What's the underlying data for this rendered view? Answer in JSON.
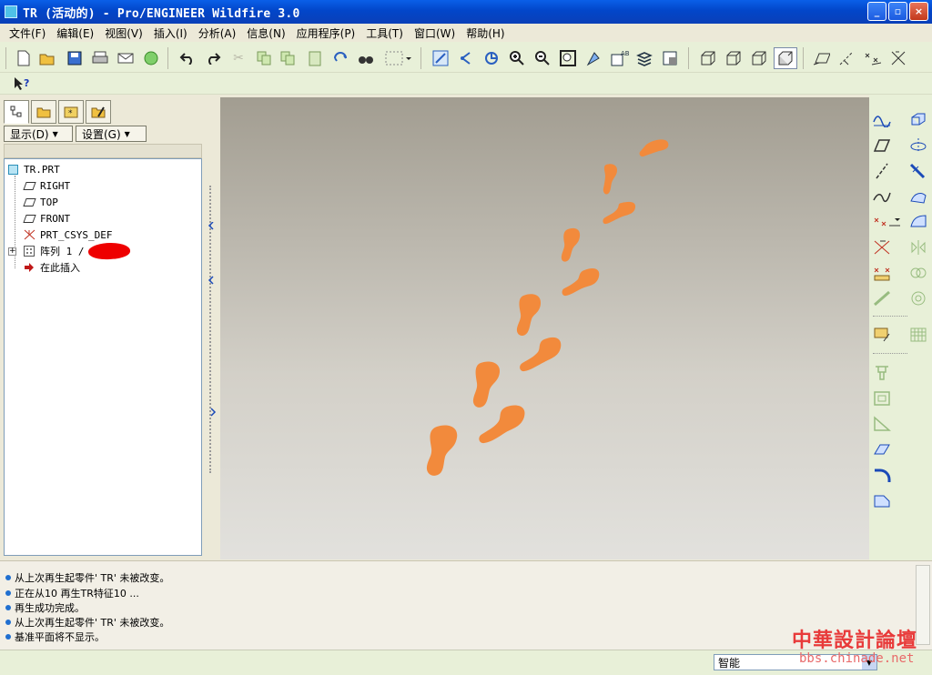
{
  "window": {
    "title": "TR (活动的) - Pro/ENGINEER Wildfire 3.0",
    "min_label": "_",
    "max_label": "▫",
    "close_label": "×"
  },
  "menu": [
    "文件(F)",
    "编辑(E)",
    "视图(V)",
    "插入(I)",
    "分析(A)",
    "信息(N)",
    "应用程序(P)",
    "工具(T)",
    "窗口(W)",
    "帮助(H)"
  ],
  "model_tree": {
    "display_button": "显示(D)",
    "settings_button": "设置(G)",
    "items": [
      "TR.PRT",
      "RIGHT",
      "TOP",
      "FRONT",
      "PRT_CSYS_DEF",
      "阵列 1 /",
      "在此插入"
    ]
  },
  "messages": [
    "从上次再生起零件' TR' 未被改变。",
    "正在从10 再生TR特征10 ...",
    "再生成功完成。",
    "从上次再生起零件' TR' 未被改变。",
    "基准平面将不显示。"
  ],
  "status": {
    "filter_value": "智能"
  },
  "watermark": {
    "title": "中華設計論壇",
    "url": "bbs.chinade.net"
  },
  "colors": {
    "footprint": "#f28a3c",
    "title_bar": "#0a5fe8"
  }
}
